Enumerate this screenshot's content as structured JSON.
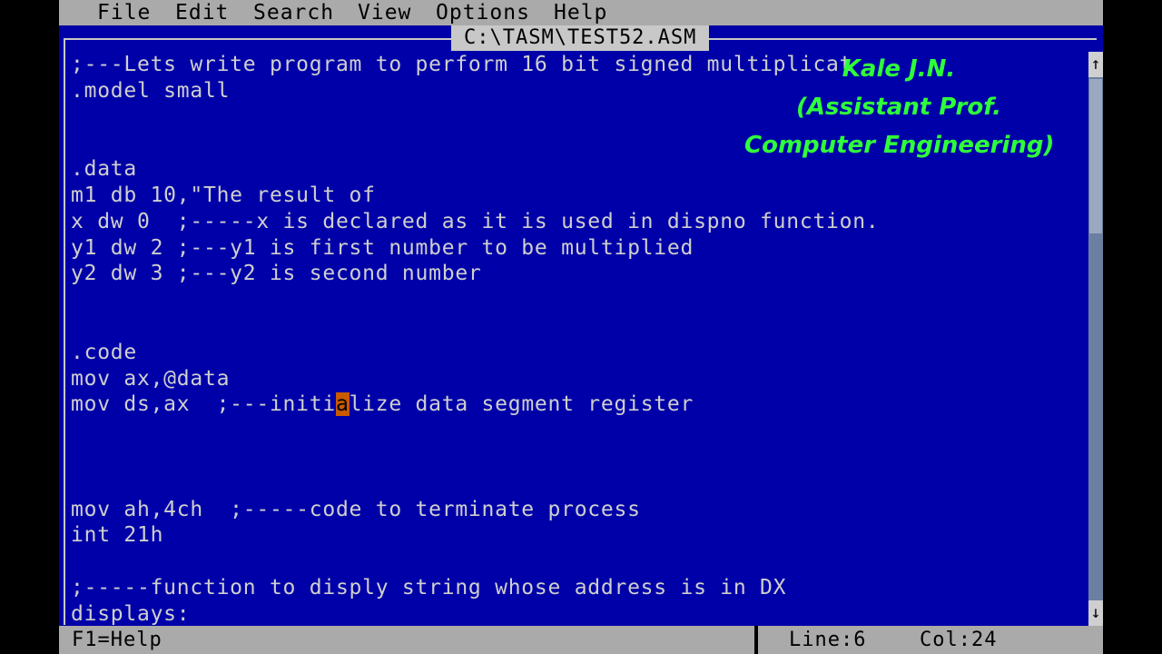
{
  "menu": {
    "items": [
      "File",
      "Edit",
      "Search",
      "View",
      "Options",
      "Help"
    ]
  },
  "editor": {
    "file_title": "C:\\TASM\\TEST52.ASM",
    "lines": [
      ";---Lets write program to perform 16 bit signed multiplicat",
      ".model small",
      "",
      "",
      ".data",
      "m1 db 10,\"The result of",
      "x dw 0  ;-----x is declared as it is used in dispno function.",
      "y1 dw 2 ;---y1 is first number to be multiplied",
      "y2 dw 3 ;---y2 is second number",
      "",
      "",
      ".code",
      "mov ax,@data",
      "mov ds,ax  ;---initialize data segment register",
      "",
      "",
      "",
      "mov ah,4ch  ;-----code to terminate process",
      "int 21h",
      "",
      ";-----function to disply string whose address is in DX",
      "displays:"
    ],
    "cursor": {
      "line_prefix": "mov ds,ax  ;---initi",
      "char": "a",
      "line_suffix": "lize data segment register"
    }
  },
  "scrollbar": {
    "up_arrow": "↑",
    "down_arrow": "↓"
  },
  "status": {
    "help": "F1=Help",
    "line": "Line:6",
    "col": "Col:24"
  },
  "watermark": {
    "lines": [
      "Kale J.N.",
      "(Assistant Prof.",
      "Computer Engineering)"
    ]
  }
}
